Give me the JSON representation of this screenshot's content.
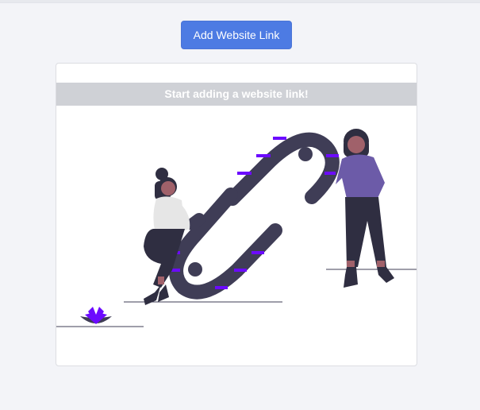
{
  "toolbar": {
    "add_link_label": "Add Website Link"
  },
  "empty_state": {
    "message": "Start adding a website link!"
  },
  "colors": {
    "primary": "#4d7be3",
    "accent": "#6c0aff",
    "link_dark": "#3f3d56",
    "banner_bg": "#cfd1d6"
  }
}
